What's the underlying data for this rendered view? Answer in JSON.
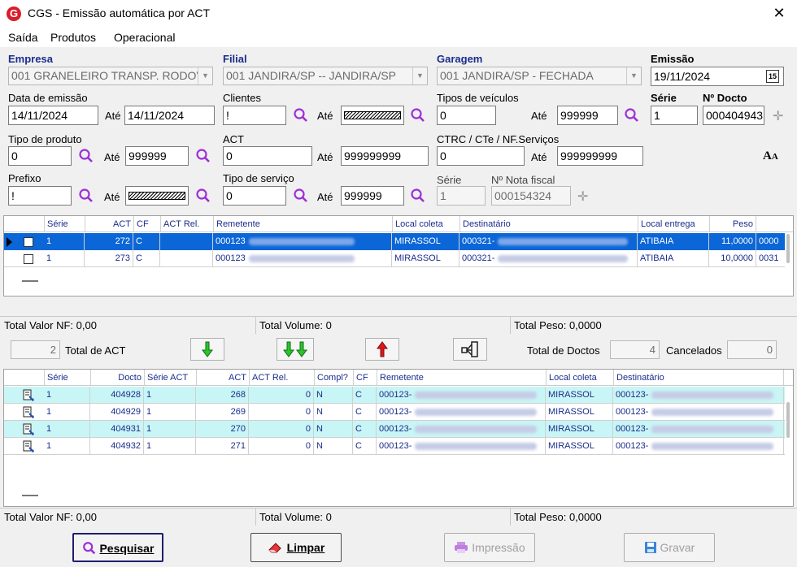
{
  "window": {
    "title": "CGS - Emissão automática por ACT",
    "app_icon": "G"
  },
  "menu": [
    "Saída",
    "Produtos",
    "Operacional"
  ],
  "filters": {
    "empresa_label": "Empresa",
    "empresa_value": "001 GRANELEIRO TRANSP. RODOV",
    "filial_label": "Filial",
    "filial_value": "001 JANDIRA/SP -- JANDIRA/SP",
    "garagem_label": "Garagem",
    "garagem_value": "001 JANDIRA/SP - FECHADA",
    "emissao_label": "Emissão",
    "emissao_value": "19/11/2024",
    "data_emissao_label": "Data de emissão",
    "data_emissao_de": "14/11/2024",
    "ate": "Até",
    "data_emissao_ate": "14/11/2024",
    "clientes_label": "Clientes",
    "clientes_de": "!",
    "tipos_veiculos_label": "Tipos de veículos",
    "tipos_veiculos_de": "0",
    "tipos_veiculos_ate": "999999",
    "serie_label": "Série",
    "serie_value": "1",
    "num_docto_label": "Nº Docto",
    "num_docto_value": "000404943",
    "tipo_produto_label": "Tipo de produto",
    "tipo_produto_de": "0",
    "tipo_produto_ate": "999999",
    "act_label": "ACT",
    "act_de": "0",
    "act_ate": "999999999",
    "ctrc_label": "CTRC / CTe / NF.Serviços",
    "ctrc_de": "0",
    "ctrc_ate": "999999999",
    "prefixo_label": "Prefixo",
    "prefixo_de": "!",
    "tipo_servico_label": "Tipo de serviço",
    "tipo_servico_de": "0",
    "tipo_servico_ate": "999999",
    "serie2_label": "Série",
    "serie2_value": "1",
    "nota_fiscal_label": "Nº Nota fiscal",
    "nota_fiscal_value": "000154324"
  },
  "grid1": {
    "headers": [
      "Série",
      "ACT",
      "CF",
      "ACT Rel.",
      "Remetente",
      "Local coleta",
      "Destinatário",
      "Local entrega",
      "Peso"
    ],
    "rows": [
      {
        "serie": "1",
        "act": "272",
        "cf": "C",
        "act_rel": "",
        "remetente": "000123",
        "local_coleta": "MIRASSOL",
        "destinatario": "000321-",
        "local_entrega": "ATIBAIA",
        "peso": "11,0000",
        "extra": "0000"
      },
      {
        "serie": "1",
        "act": "273",
        "cf": "C",
        "act_rel": "",
        "remetente": "000123",
        "local_coleta": "MIRASSOL",
        "destinatario": "000321-",
        "local_entrega": "ATIBAIA",
        "peso": "10,0000",
        "extra": "0031"
      }
    ]
  },
  "totals1": {
    "valor_nf_label": "Total Valor NF:",
    "valor_nf": "0,00",
    "volume_label": "Total Volume:",
    "volume": "0",
    "peso_label": "Total Peso:",
    "peso": "0,0000"
  },
  "middle": {
    "total_act_value": "2",
    "total_act_label": "Total de ACT",
    "total_doctos_label": "Total de Doctos",
    "total_doctos_value": "4",
    "cancelados_label": "Cancelados",
    "cancelados_value": "0"
  },
  "grid2": {
    "headers": [
      "Série",
      "Docto",
      "Série ACT",
      "ACT",
      "ACT Rel.",
      "Compl?",
      "CF",
      "Remetente",
      "Local coleta",
      "Destinatário"
    ],
    "rows": [
      {
        "serie": "1",
        "docto": "404928",
        "serie_act": "1",
        "act": "268",
        "act_rel": "0",
        "compl": "N",
        "cf": "C",
        "remetente": "000123-",
        "local_coleta": "MIRASSOL",
        "destinatario": "000123-"
      },
      {
        "serie": "1",
        "docto": "404929",
        "serie_act": "1",
        "act": "269",
        "act_rel": "0",
        "compl": "N",
        "cf": "C",
        "remetente": "000123-",
        "local_coleta": "MIRASSOL",
        "destinatario": "000123-"
      },
      {
        "serie": "1",
        "docto": "404931",
        "serie_act": "1",
        "act": "270",
        "act_rel": "0",
        "compl": "N",
        "cf": "C",
        "remetente": "000123-",
        "local_coleta": "MIRASSOL",
        "destinatario": "000123-"
      },
      {
        "serie": "1",
        "docto": "404932",
        "serie_act": "1",
        "act": "271",
        "act_rel": "0",
        "compl": "N",
        "cf": "C",
        "remetente": "000123-",
        "local_coleta": "MIRASSOL",
        "destinatario": "000123-"
      }
    ]
  },
  "totals2": {
    "valor_nf_label": "Total Valor NF:",
    "valor_nf": "0,00",
    "volume_label": "Total Volume:",
    "volume": "0",
    "peso_label": "Total Peso:",
    "peso": "0,0000"
  },
  "buttons": {
    "pesquisar": "Pesquisar",
    "limpar": "Limpar",
    "impressao": "Impressão",
    "gravar": "Gravar"
  },
  "colors": {
    "selected_row": "#0b66d8",
    "alt_row": "#c8f5f5",
    "label_blue": "#1a2d8c",
    "magnifier": "#9c2fd8"
  }
}
